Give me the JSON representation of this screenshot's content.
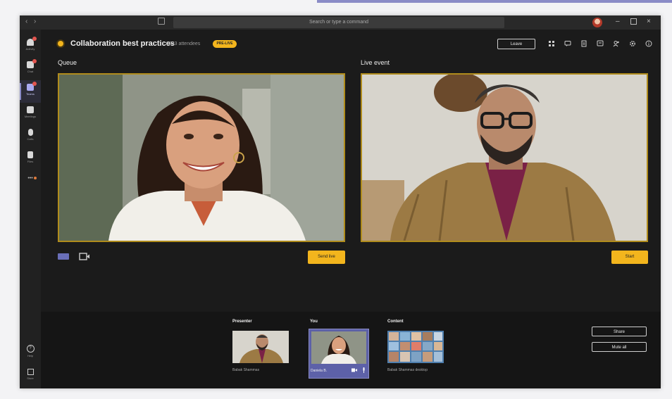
{
  "titlebar": {
    "search_placeholder": "Search or type a command"
  },
  "rail": {
    "items": [
      {
        "label": "Activity",
        "icon": "bell-icon",
        "badge": true
      },
      {
        "label": "Chat",
        "icon": "chat-icon",
        "badge": true
      },
      {
        "label": "Teams",
        "icon": "teams-icon",
        "badge": true,
        "active": true
      },
      {
        "label": "Meetings",
        "icon": "calendar-icon"
      },
      {
        "label": "Calls",
        "icon": "phone-icon"
      },
      {
        "label": "Files",
        "icon": "file-icon"
      },
      {
        "label": "•••",
        "icon": "more-icon"
      }
    ],
    "help_label": "Help",
    "store_label": "Store"
  },
  "meeting": {
    "title": "Collaboration best practices",
    "attendees": "3333 attendees",
    "status_badge": "PRE-LIVE",
    "leave_label": "Leave"
  },
  "queue": {
    "label": "Queue",
    "send_live_label": "Send live"
  },
  "live": {
    "label": "Live event",
    "start_label": "Start"
  },
  "strip": {
    "presenter_label": "Presenter",
    "presenter_caption": "Babak Shammas",
    "you_label": "You",
    "you_name": "Daniela B.",
    "content_label": "Content",
    "content_caption": "Babak Shammas desktop",
    "share_label": "Share",
    "mute_all_label": "Mute all"
  },
  "colors": {
    "accent": "#f3b51d",
    "brand": "#8b8cc7",
    "background": "#1b1b1b"
  }
}
